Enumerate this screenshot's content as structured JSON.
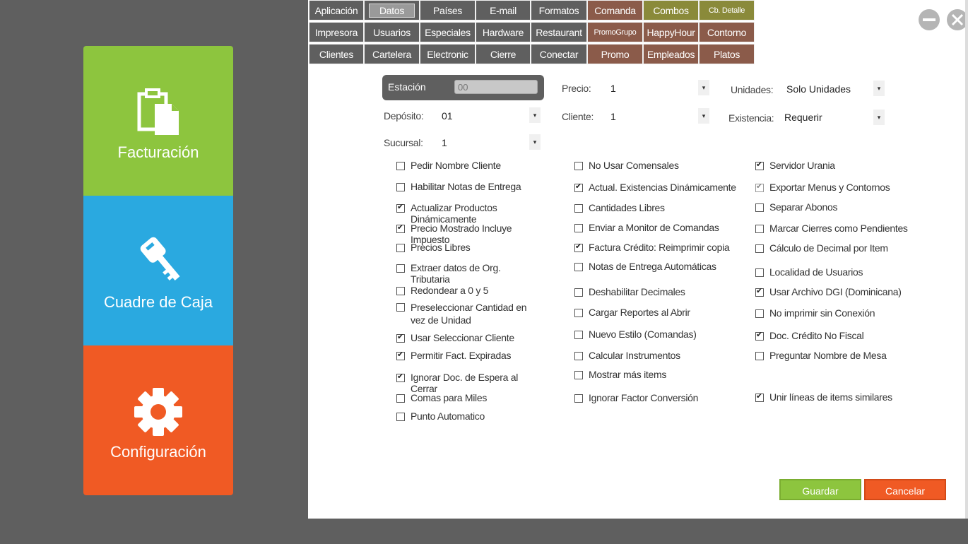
{
  "sidebar": {
    "facturacion": "Facturación",
    "caja": "Cuadre de Caja",
    "config": "Configuración"
  },
  "tabs": [
    {
      "label": "Aplicación"
    },
    {
      "label": "Datos"
    },
    {
      "label": "Países"
    },
    {
      "label": "E-mail"
    },
    {
      "label": "Formatos"
    },
    {
      "label": "Comanda"
    },
    {
      "label": "Combos"
    },
    {
      "label": "Cb. Detalle"
    },
    {
      "label": "Impresora"
    },
    {
      "label": "Usuarios"
    },
    {
      "label": "Especiales"
    },
    {
      "label": "Hardware"
    },
    {
      "label": "Restaurant"
    },
    {
      "label": "PromoGrupo"
    },
    {
      "label": "HappyHour"
    },
    {
      "label": "Contorno"
    },
    {
      "label": "Clientes"
    },
    {
      "label": "Cartelera"
    },
    {
      "label": "Electronic"
    },
    {
      "label": "Cierre"
    },
    {
      "label": "Conectar"
    },
    {
      "label": "Promo"
    },
    {
      "label": "Empleados"
    },
    {
      "label": "Platos"
    }
  ],
  "form": {
    "estacion_label": "Estación",
    "estacion_value": "00",
    "precio_label": "Precio:",
    "precio_value": "1",
    "unidades_label": "Unidades:",
    "unidades_value": "Solo Unidades",
    "deposito_label": "Depósito:",
    "deposito_value": "01",
    "cliente_label": "Cliente:",
    "cliente_value": "1",
    "existencia_label": "Existencia:",
    "existencia_value": "Requerir",
    "sucursal_label": "Sucursal:",
    "sucursal_value": "1",
    "dropdown_glyph": "▾"
  },
  "checks": {
    "c1": [
      {
        "label": "Pedir Nombre Cliente",
        "checked": false
      },
      {
        "label": "Habilitar Notas de Entrega",
        "checked": false
      },
      {
        "label": "Actualizar Productos Dinámicamente",
        "checked": true
      },
      {
        "label": "Precio Mostrado Incluye Impuesto",
        "checked": true
      },
      {
        "label": "Precios Libres",
        "checked": false
      },
      {
        "label": "Extraer datos de Org. Tributaria",
        "checked": false
      },
      {
        "label": "Redondear a 0 y 5",
        "checked": false
      },
      {
        "label": "Preseleccionar  Cantidad  en vez de Unidad",
        "checked": false
      },
      {
        "label": "Usar Seleccionar Cliente",
        "checked": true
      },
      {
        "label": "Permitir Fact. Expiradas",
        "checked": true
      },
      {
        "label": "Ignorar Doc. de Espera al Cerrar",
        "checked": true
      },
      {
        "label": "Comas para Miles",
        "checked": false
      },
      {
        "label": "Punto Automatico",
        "checked": false
      }
    ],
    "c2": [
      {
        "label": "No Usar Comensales",
        "checked": false
      },
      {
        "label": "Actual. Existencias Dinámicamente",
        "checked": true
      },
      {
        "label": "Cantidades Libres",
        "checked": false
      },
      {
        "label": "Enviar a Monitor de Comandas",
        "checked": false
      },
      {
        "label": "Factura Crédito: Reimprimir copia",
        "checked": true
      },
      {
        "label": "Notas de Entrega Automáticas",
        "checked": false
      },
      {
        "label": "Deshabilitar Decimales",
        "checked": false
      },
      {
        "label": "Cargar Reportes al Abrir",
        "checked": false
      },
      {
        "label": "Nuevo Estilo (Comandas)",
        "checked": false
      },
      {
        "label": "Calcular Instrumentos",
        "checked": false
      },
      {
        "label": "Mostrar más items",
        "checked": false
      },
      {
        "label": "Ignorar Factor Conversión",
        "checked": false
      }
    ],
    "c3": [
      {
        "label": "Servidor Urania",
        "checked": true
      },
      {
        "label": "Exportar Menus y Contornos",
        "checked": true
      },
      {
        "label": "Separar Abonos",
        "checked": false
      },
      {
        "label": "Marcar Cierres como Pendientes",
        "checked": false
      },
      {
        "label": "Cálculo de Decimal por Item",
        "checked": false
      },
      {
        "label": "Localidad de Usuarios",
        "checked": false
      },
      {
        "label": "Usar Archivo DGI (Dominicana)",
        "checked": true
      },
      {
        "label": "No imprimir sin Conexión",
        "checked": false
      },
      {
        "label": "Doc. Crédito No Fiscal",
        "checked": true
      },
      {
        "label": "Preguntar Nombre de Mesa",
        "checked": false
      },
      {
        "label": "Unir líneas de items similares",
        "checked": true
      }
    ]
  },
  "buttons": {
    "save": "Guardar",
    "cancel": "Cancelar"
  }
}
